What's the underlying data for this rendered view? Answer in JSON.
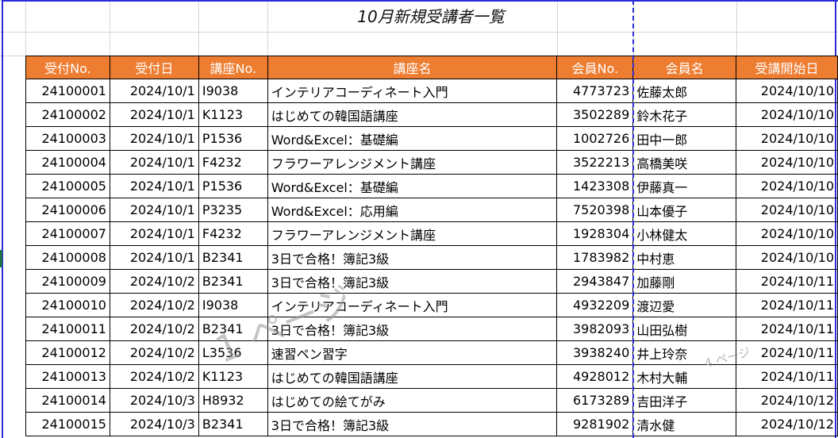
{
  "sheet": {
    "title": "10月新規受講者一覧"
  },
  "table": {
    "headers": [
      "受付No.",
      "受付日",
      "講座No.",
      "講座名",
      "会員No.",
      "会員名",
      "受講開始日"
    ],
    "rows": [
      [
        "24100001",
        "2024/10/1",
        "I9038",
        "インテリアコーディネート入門",
        "4773723",
        "佐藤太郎",
        "2024/10/10"
      ],
      [
        "24100002",
        "2024/10/1",
        "K1123",
        "はじめての韓国語講座",
        "3502289",
        "鈴木花子",
        "2024/10/10"
      ],
      [
        "24100003",
        "2024/10/1",
        "P1536",
        "Word&Excel：基礎編",
        "1002726",
        "田中一郎",
        "2024/10/10"
      ],
      [
        "24100004",
        "2024/10/1",
        "F4232",
        "フラワーアレンジメント講座",
        "3522213",
        "高橋美咲",
        "2024/10/10"
      ],
      [
        "24100005",
        "2024/10/1",
        "P1536",
        "Word&Excel：基礎編",
        "1423308",
        "伊藤真一",
        "2024/10/10"
      ],
      [
        "24100006",
        "2024/10/1",
        "P3235",
        "Word&Excel：応用編",
        "7520398",
        "山本優子",
        "2024/10/10"
      ],
      [
        "24100007",
        "2024/10/1",
        "F4232",
        "フラワーアレンジメント講座",
        "1928304",
        "小林健太",
        "2024/10/10"
      ],
      [
        "24100008",
        "2024/10/1",
        "B2341",
        "3日で合格！簿記3級",
        "1783982",
        "中村恵",
        "2024/10/10"
      ],
      [
        "24100009",
        "2024/10/2",
        "B2341",
        "3日で合格！簿記3級",
        "2943847",
        "加藤剛",
        "2024/10/11"
      ],
      [
        "24100010",
        "2024/10/2",
        "I9038",
        "インテリアコーディネート入門",
        "4932209",
        "渡辺愛",
        "2024/10/11"
      ],
      [
        "24100011",
        "2024/10/2",
        "B2341",
        "3日で合格！簿記3級",
        "3982093",
        "山田弘樹",
        "2024/10/11"
      ],
      [
        "24100012",
        "2024/10/2",
        "L3536",
        "速習ペン習字",
        "3938240",
        "井上玲奈",
        "2024/10/11"
      ],
      [
        "24100013",
        "2024/10/2",
        "K1123",
        "はじめての韓国語講座",
        "4928012",
        "木村大輔",
        "2024/10/11"
      ],
      [
        "24100014",
        "2024/10/3",
        "H8932",
        "はじめての絵てがみ",
        "6173289",
        "吉田洋子",
        "2024/10/12"
      ],
      [
        "24100015",
        "2024/10/3",
        "B2341",
        "3日で合格！簿記3級",
        "9281902",
        "清水健",
        "2024/10/12"
      ]
    ]
  },
  "watermarks": {
    "page1": "1 ページ",
    "page4": "4 ページ"
  },
  "colors": {
    "header_bg": "#ed7d31",
    "header_text": "#ffffff",
    "page_break": "#2a2adb"
  }
}
